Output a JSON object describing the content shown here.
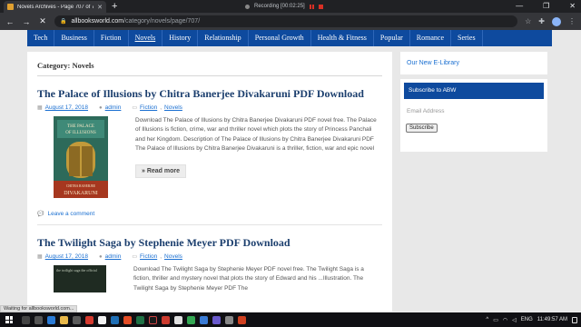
{
  "browser": {
    "tab_title": "Novels Archives - Page 707 of 7",
    "recording_label": "Recording [00:02:25]",
    "url_domain": "allbooksworld.com",
    "url_path": "/category/novels/page/707/",
    "status_text": "Waiting for allbooksworld.com..."
  },
  "nav": {
    "items": [
      "Tech",
      "Business",
      "Fiction",
      "Novels",
      "History",
      "Relationship",
      "Personal Growth",
      "Health & Fitness",
      "Popular",
      "Romance",
      "Series"
    ],
    "active": "Novels"
  },
  "main": {
    "category_title": "Category: Novels",
    "posts": [
      {
        "title": "The Palace of Illusions by Chitra Banerjee Divakaruni PDF Download",
        "date": "August 17, 2018",
        "author": "admin",
        "cat1": "Fiction",
        "cat2": "Novels",
        "excerpt": "Download The Palace of Illusions by Chitra Banerjee Divakaruni PDF novel free. The Palace of Illusions is fiction, crime, war and thriller novel which plots the story of Princess Panchali and her Kingdom. Description of The Palace of Illusions by Chitra Banerjee Divakaruni PDF The Palace of Illusions by Chitra Banerjee Divakaruni is a thriller, fiction, war and epic novel",
        "read_more": "» Read more",
        "comment": "Leave a comment",
        "cover_title": "THE PALACE OF ILLUSIONS",
        "cover_author_first": "CHITRA BANERJEE",
        "cover_author_last": "DIVAKARUNI"
      },
      {
        "title": "The Twilight Saga by Stephenie Meyer PDF Download",
        "date": "August 17, 2018",
        "author": "admin",
        "cat1": "Fiction",
        "cat2": "Novels",
        "excerpt": "Download The Twilight Saga by Stephenie Meyer PDF novel free. The Twilight Saga is a fiction, thriller and mystery novel that plots the story of Edward and his",
        "excerpt_cut": "...Illustration. The Twilight Saga by Stephenie Meyer PDF The",
        "cover_title": "the twilight saga the official"
      }
    ]
  },
  "sidebar": {
    "library_link": "Our New E-Library",
    "subscribe_title": "Subscribe to ABW",
    "email_placeholder": "Email Address",
    "subscribe_button": "Subscribe"
  },
  "taskbar": {
    "lang": "ENG",
    "time": "11:49:57 AM"
  },
  "colors": {
    "brand_blue": "#0e4a9e",
    "title_blue": "#1c3f6e",
    "link_blue": "#1a6fd1"
  }
}
